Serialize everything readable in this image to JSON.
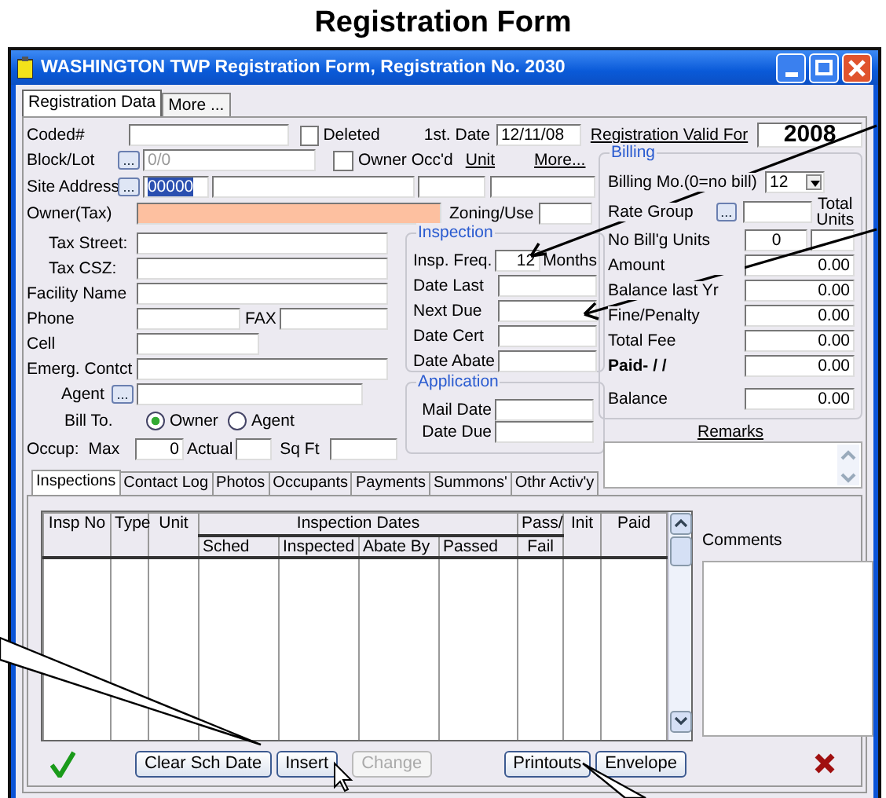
{
  "heading": "Registration Form",
  "window": {
    "title": "WASHINGTON TWP Registration Form, Registration No. 2030"
  },
  "tabs": [
    {
      "label": "Registration Data",
      "selected": true
    },
    {
      "label": "More ...",
      "selected": false
    }
  ],
  "record": {
    "coded_label": "Coded#",
    "deleted": {
      "label": "Deleted",
      "checked": false
    },
    "first_date": {
      "label": "1st. Date",
      "value": "12/11/08"
    },
    "valid_for": {
      "label": "Registration Valid For",
      "value": "2008"
    },
    "block_lot": {
      "label": "Block/Lot",
      "button": "...",
      "value": "0/0",
      "disabled": true
    },
    "owner_occ": {
      "label": "Owner Occ'd",
      "checked": false
    },
    "unit_link": "Unit",
    "more_link": "More...",
    "site_address": {
      "label": "Site Address",
      "button": "...",
      "value": "00000",
      "text_selected": true
    },
    "owner": {
      "label": "Owner(Tax)",
      "highlighted": true
    },
    "zoning": {
      "label": "Zoning/Use"
    }
  },
  "owner_rows": [
    {
      "kind": "address",
      "label": "Tax Street:"
    },
    {
      "kind": "address",
      "label": "Tax CSZ:"
    },
    {
      "kind": "text",
      "label": "Facility Name"
    },
    {
      "kind": "phone",
      "label": "Phone",
      "fax_label": "FAX"
    },
    {
      "kind": "short",
      "label": "Cell"
    },
    {
      "kind": "text",
      "label": "Emerg. Contct"
    },
    {
      "kind": "lookup",
      "label": "Agent",
      "button": "..."
    },
    {
      "kind": "radio",
      "label": "Bill To.",
      "options": [
        {
          "label": "Owner",
          "selected": true
        },
        {
          "label": "Agent",
          "selected": false
        }
      ]
    },
    {
      "kind": "occupancy",
      "label": "Occup:",
      "max_label": "Max",
      "value": "0",
      "actual_label": "Actual",
      "sqft_label": "Sq Ft"
    }
  ],
  "inspection": {
    "title": "Inspection",
    "rows": [
      {
        "label": "Insp. Freq.",
        "value": "12",
        "suffix": "Months"
      },
      {
        "label": "Date Last"
      },
      {
        "label": "Next Due"
      },
      {
        "label": "Date Cert"
      },
      {
        "label": "Date Abate"
      }
    ]
  },
  "application": {
    "title": "Application",
    "rows": [
      {
        "label": "Mail Date"
      },
      {
        "label": "Date Due"
      }
    ]
  },
  "billing": {
    "title": "Billing",
    "rows": [
      {
        "kind": "select",
        "label": "Billing Mo.(0=no bill)",
        "value": "12"
      },
      {
        "kind": "lookup",
        "label": "Rate Group",
        "button": "...",
        "note": "Total Units"
      },
      {
        "kind": "units",
        "label": "No Bill'g Units",
        "value": "0"
      },
      {
        "kind": "amount",
        "label": "Amount",
        "value": "0.00",
        "bold": false
      },
      {
        "kind": "amount",
        "label": "Balance last Yr",
        "value": "0.00",
        "bold": false
      },
      {
        "kind": "amount",
        "label": "Fine/Penalty",
        "value": "0.00",
        "bold": false
      },
      {
        "kind": "amount",
        "label": "Total Fee",
        "value": "0.00",
        "bold": false
      },
      {
        "kind": "amount",
        "label": "Paid-  /  /",
        "value": "0.00",
        "bold": true
      },
      {
        "kind": "balance",
        "label": "Balance",
        "value": "0.00",
        "bold": false
      }
    ]
  },
  "remarks": {
    "label": "Remarks"
  },
  "detail_tabs": [
    {
      "label": "Inspections",
      "selected": true
    },
    {
      "label": "Contact Log",
      "selected": false
    },
    {
      "label": "Photos",
      "selected": false
    },
    {
      "label": "Occupants",
      "selected": false
    },
    {
      "label": "Payments",
      "selected": false
    },
    {
      "label": "Summons'",
      "selected": false
    },
    {
      "label": "Othr Activ'y",
      "selected": false
    }
  ],
  "table": {
    "group_label": "Inspection Dates",
    "columns": [
      {
        "label": "Insp No",
        "grouped": false
      },
      {
        "label": "Type",
        "grouped": false
      },
      {
        "label": "Unit",
        "grouped": false
      },
      {
        "label": "Sched",
        "grouped": true
      },
      {
        "label": "Inspected",
        "grouped": true
      },
      {
        "label": "Abate By",
        "grouped": true
      },
      {
        "label": "Passed",
        "grouped": true
      },
      {
        "label": "Pass/",
        "sublabel": "Fail",
        "grouped": false
      },
      {
        "label": "Init",
        "grouped": false
      },
      {
        "label": "Paid",
        "grouped": false
      }
    ]
  },
  "comments": {
    "label": "Comments"
  },
  "buttons": [
    {
      "label": "Clear Sch Date",
      "disabled": false
    },
    {
      "label": "Insert",
      "disabled": false
    },
    {
      "label": "Change",
      "disabled": true
    },
    {
      "label": "Printouts",
      "disabled": false
    },
    {
      "label": "Envelope",
      "disabled": false
    }
  ]
}
